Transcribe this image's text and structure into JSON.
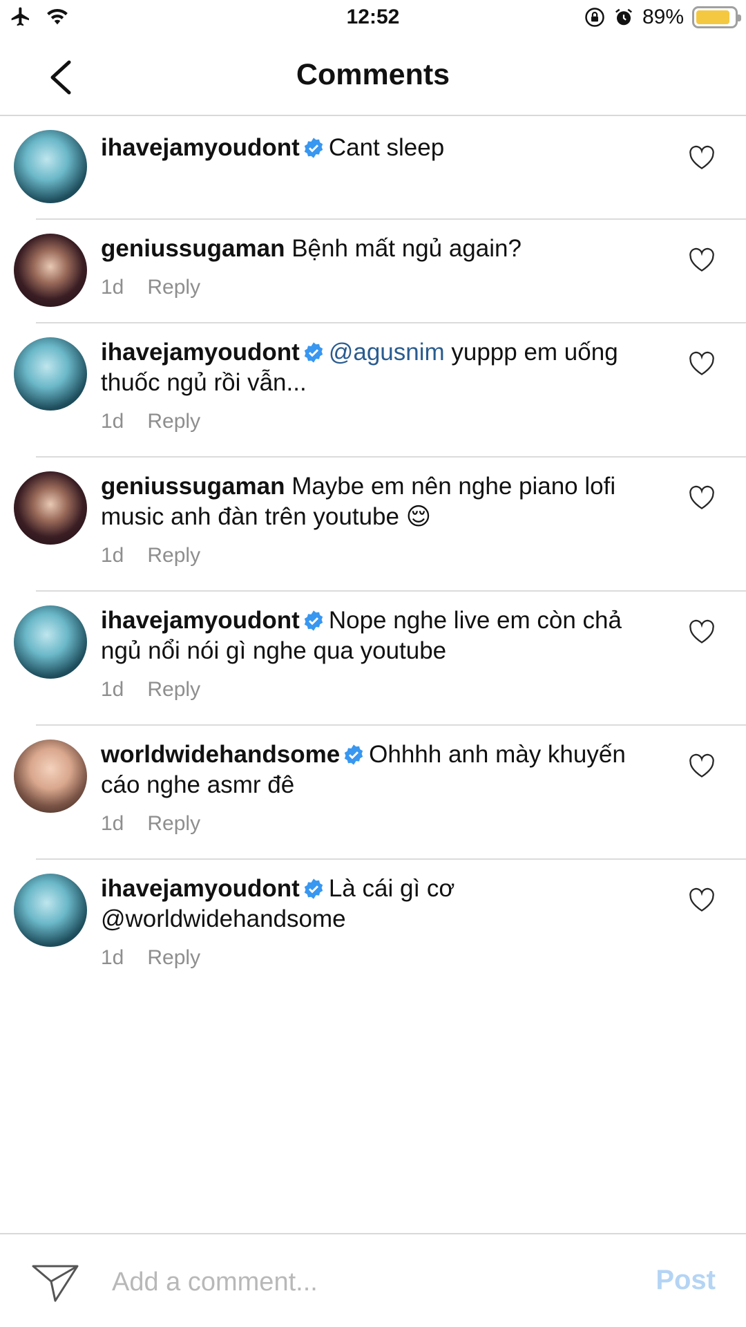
{
  "status_bar": {
    "time": "12:52",
    "battery": "89%",
    "battery_level": 0.89
  },
  "header": {
    "title": "Comments"
  },
  "comments": [
    {
      "user": "ihavejamyoudont",
      "verified": true,
      "text": "Cant sleep",
      "mention": "",
      "time": "",
      "reply": ""
    },
    {
      "user": "geniussugaman",
      "verified": false,
      "text": "Bệnh mất ngủ again?",
      "mention": "",
      "time": "1d",
      "reply": "Reply"
    },
    {
      "user": "ihavejamyoudont",
      "verified": true,
      "mention": "@agusnim",
      "text": " yuppp em uống thuốc ngủ rồi vẫn...",
      "time": "1d",
      "reply": "Reply"
    },
    {
      "user": "geniussugaman",
      "verified": false,
      "text": "Maybe em nên nghe piano lofi music anh đàn trên youtube 😌",
      "mention": "",
      "time": "1d",
      "reply": "Reply"
    },
    {
      "user": "ihavejamyoudont",
      "verified": true,
      "text": "Nope nghe live em còn chả ngủ nổi nói gì nghe qua youtube",
      "mention": "",
      "time": "1d",
      "reply": "Reply"
    },
    {
      "user": "worldwidehandsome",
      "verified": true,
      "text": "Ohhhh anh mày khuyến cáo nghe asmr đê",
      "mention": "",
      "time": "1d",
      "reply": "Reply"
    },
    {
      "user": "ihavejamyoudont",
      "verified": true,
      "text": "Là cái gì cơ @worldwidehandsome",
      "mention": "",
      "time": "1d",
      "reply": "Reply"
    }
  ],
  "composer": {
    "placeholder": "Add a comment...",
    "post_label": "Post"
  },
  "colors": {
    "mention": "#2a5c8f",
    "verified_badge": "#3897f0",
    "post_disabled": "#b5d4f4",
    "battery_fill": "#f5c842"
  }
}
